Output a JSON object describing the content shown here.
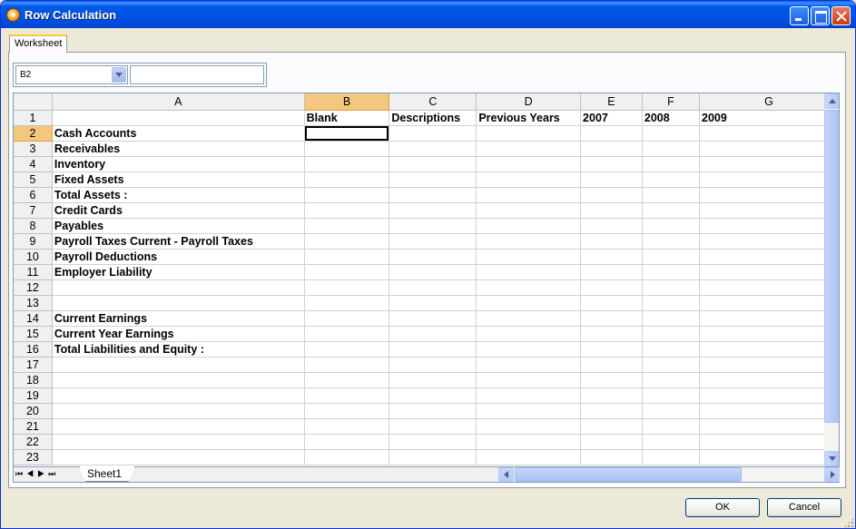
{
  "window": {
    "title": "Row Calculation"
  },
  "tabs": [
    {
      "label": "Worksheet"
    }
  ],
  "name_box": {
    "value": "B2"
  },
  "formula_bar": {
    "value": ""
  },
  "grid": {
    "columns": [
      "A",
      "B",
      "C",
      "D",
      "E",
      "F",
      "G"
    ],
    "selected_cell": "B2",
    "rows": [
      {
        "num": "1",
        "cells": [
          "",
          "Blank",
          "Descriptions",
          "Previous Years",
          "2007",
          "2008",
          "2009"
        ]
      },
      {
        "num": "2",
        "cells": [
          "Cash Accounts",
          "",
          "",
          "",
          "",
          "",
          ""
        ]
      },
      {
        "num": "3",
        "cells": [
          "Receivables",
          "",
          "",
          "",
          "",
          "",
          ""
        ]
      },
      {
        "num": "4",
        "cells": [
          "Inventory",
          "",
          "",
          "",
          "",
          "",
          ""
        ]
      },
      {
        "num": "5",
        "cells": [
          "Fixed Assets",
          "",
          "",
          "",
          "",
          "",
          ""
        ]
      },
      {
        "num": "6",
        "cells": [
          "Total Assets :",
          "",
          "",
          "",
          "",
          "",
          ""
        ]
      },
      {
        "num": "7",
        "cells": [
          "Credit Cards",
          "",
          "",
          "",
          "",
          "",
          ""
        ]
      },
      {
        "num": "8",
        "cells": [
          "Payables",
          "",
          "",
          "",
          "",
          "",
          ""
        ]
      },
      {
        "num": "9",
        "cells": [
          "Payroll Taxes Current - Payroll Taxes",
          "",
          "",
          "",
          "",
          "",
          ""
        ]
      },
      {
        "num": "10",
        "cells": [
          "Payroll Deductions",
          "",
          "",
          "",
          "",
          "",
          ""
        ]
      },
      {
        "num": "11",
        "cells": [
          "Employer Liability",
          "",
          "",
          "",
          "",
          "",
          ""
        ]
      },
      {
        "num": "12",
        "cells": [
          "",
          "",
          "",
          "",
          "",
          "",
          ""
        ]
      },
      {
        "num": "13",
        "cells": [
          "",
          "",
          "",
          "",
          "",
          "",
          ""
        ]
      },
      {
        "num": "14",
        "cells": [
          "Current Earnings",
          "",
          "",
          "",
          "",
          "",
          ""
        ]
      },
      {
        "num": "15",
        "cells": [
          "Current Year Earnings",
          "",
          "",
          "",
          "",
          "",
          ""
        ]
      },
      {
        "num": "16",
        "cells": [
          "Total Liabilities and Equity :",
          "",
          "",
          "",
          "",
          "",
          ""
        ]
      },
      {
        "num": "17",
        "cells": [
          "",
          "",
          "",
          "",
          "",
          "",
          ""
        ]
      },
      {
        "num": "18",
        "cells": [
          "",
          "",
          "",
          "",
          "",
          "",
          ""
        ]
      },
      {
        "num": "19",
        "cells": [
          "",
          "",
          "",
          "",
          "",
          "",
          ""
        ]
      },
      {
        "num": "20",
        "cells": [
          "",
          "",
          "",
          "",
          "",
          "",
          ""
        ]
      },
      {
        "num": "21",
        "cells": [
          "",
          "",
          "",
          "",
          "",
          "",
          ""
        ]
      },
      {
        "num": "22",
        "cells": [
          "",
          "",
          "",
          "",
          "",
          "",
          ""
        ]
      },
      {
        "num": "23",
        "cells": [
          "",
          "",
          "",
          "",
          "",
          "",
          ""
        ]
      }
    ]
  },
  "sheet_tabs": [
    {
      "label": "Sheet1"
    }
  ],
  "buttons": {
    "ok": "OK",
    "cancel": "Cancel"
  },
  "colors": {
    "selected_header": "#f5c77e",
    "titlebar": "#0054e3"
  }
}
